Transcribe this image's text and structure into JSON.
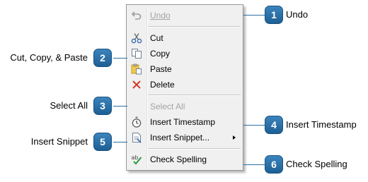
{
  "menu": {
    "items": {
      "undo": {
        "label": "Undo",
        "enabled": false,
        "icon": "undo-icon"
      },
      "cut": {
        "label": "Cut",
        "enabled": true,
        "icon": "scissors-icon"
      },
      "copy": {
        "label": "Copy",
        "enabled": true,
        "icon": "copy-icon"
      },
      "paste": {
        "label": "Paste",
        "enabled": true,
        "icon": "paste-icon"
      },
      "delete": {
        "label": "Delete",
        "enabled": true,
        "icon": "delete-x-icon"
      },
      "select_all": {
        "label": "Select All",
        "enabled": false
      },
      "insert_timestamp": {
        "label": "Insert Timestamp",
        "enabled": true,
        "icon": "stopwatch-icon"
      },
      "insert_snippet": {
        "label": "Insert Snippet...",
        "enabled": true,
        "icon": "snippet-icon",
        "has_submenu": true
      },
      "check_spelling": {
        "label": "Check Spelling",
        "enabled": true,
        "icon": "spell-check-icon"
      }
    }
  },
  "callouts": [
    {
      "number": "1",
      "label": "Undo"
    },
    {
      "number": "2",
      "label": "Cut, Copy, & Paste"
    },
    {
      "number": "3",
      "label": "Select All"
    },
    {
      "number": "4",
      "label": "Insert Timestamp"
    },
    {
      "number": "5",
      "label": "Insert Snippet"
    },
    {
      "number": "6",
      "label": "Check Spelling"
    }
  ],
  "colors": {
    "callout_badge": "#2a6ea5",
    "leader_line": "#2e6fa0",
    "menu_bg": "#f0f0f0",
    "disabled_text": "#a3a3a3"
  }
}
